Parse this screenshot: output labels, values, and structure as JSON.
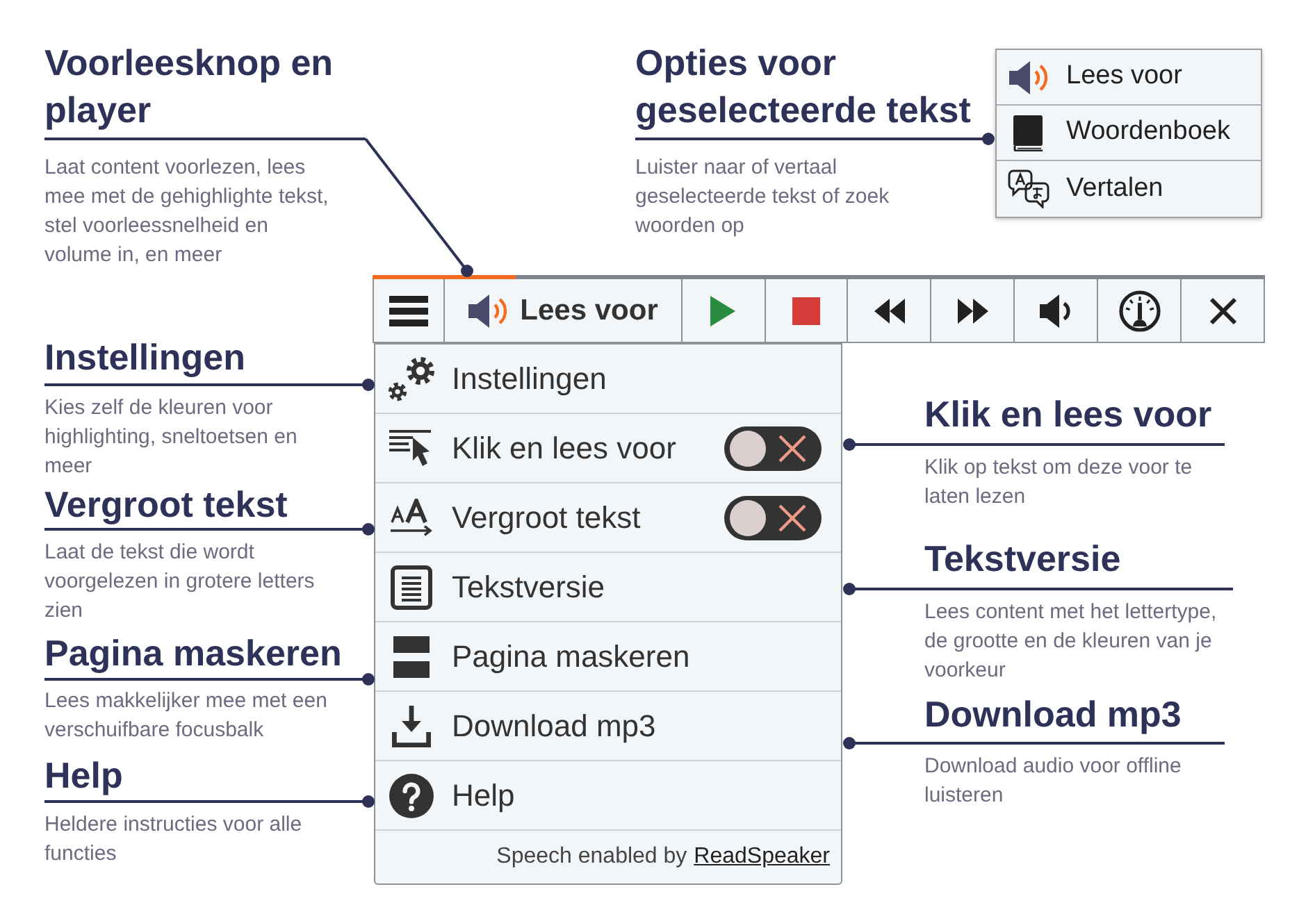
{
  "callouts": [
    {
      "title": "Voorleesknop en player",
      "description": "Laat content voorlezen, lees mee met de gehighlighte tekst, stel voorleessnelheid en volume in, en meer"
    },
    {
      "title": "Opties voor geselecteerde tekst",
      "description": "Luister naar of vertaal geselecteerde tekst of zoek woorden op"
    },
    {
      "title": "Instellingen",
      "description": "Kies zelf de kleuren voor highlighting, sneltoetsen en meer"
    },
    {
      "title": "Klik en lees voor",
      "description": "Klik op tekst om deze voor te laten lezen"
    },
    {
      "title": "Vergroot tekst",
      "description": "Laat de tekst die wordt voorgelezen in grotere letters zien"
    },
    {
      "title": "Tekstversie",
      "description": "Lees content met het lettertype, de grootte en de kleuren van je voorkeur"
    },
    {
      "title": "Pagina maskeren",
      "description": "Lees makkelijker mee met een verschuifbare focusbalk"
    },
    {
      "title": "Download mp3",
      "description": "Download audio voor offline luisteren"
    },
    {
      "title": "Help",
      "description": "Heldere instructies voor alle functies"
    }
  ],
  "selection_popup": {
    "items": [
      {
        "kind": "listen",
        "label": "Lees voor"
      },
      {
        "kind": "dictionary",
        "label": "Woordenboek"
      },
      {
        "kind": "translate",
        "label": "Vertalen"
      }
    ]
  },
  "player": {
    "progress": {
      "level": 0.16
    },
    "buttons": [
      {
        "kind": "menu"
      },
      {
        "kind": "listen",
        "label": "Lees voor"
      },
      {
        "kind": "play"
      },
      {
        "kind": "stop"
      },
      {
        "kind": "rewind"
      },
      {
        "kind": "forward"
      },
      {
        "kind": "volume"
      },
      {
        "kind": "speed"
      },
      {
        "kind": "close"
      }
    ]
  },
  "menu": {
    "items": [
      {
        "kind": "settings",
        "label": "Instellingen"
      },
      {
        "kind": "click_read",
        "label": "Klik en lees voor",
        "toggle": {
          "on": false
        }
      },
      {
        "kind": "enlarge",
        "label": "Vergroot tekst",
        "toggle": {
          "on": false
        }
      },
      {
        "kind": "text_mode",
        "label": "Tekstversie"
      },
      {
        "kind": "mask",
        "label": "Pagina maskeren"
      },
      {
        "kind": "download",
        "label": "Download mp3"
      },
      {
        "kind": "help",
        "label": "Help"
      }
    ],
    "footer": {
      "text": "Speech enabled by",
      "link": "ReadSpeaker"
    }
  }
}
